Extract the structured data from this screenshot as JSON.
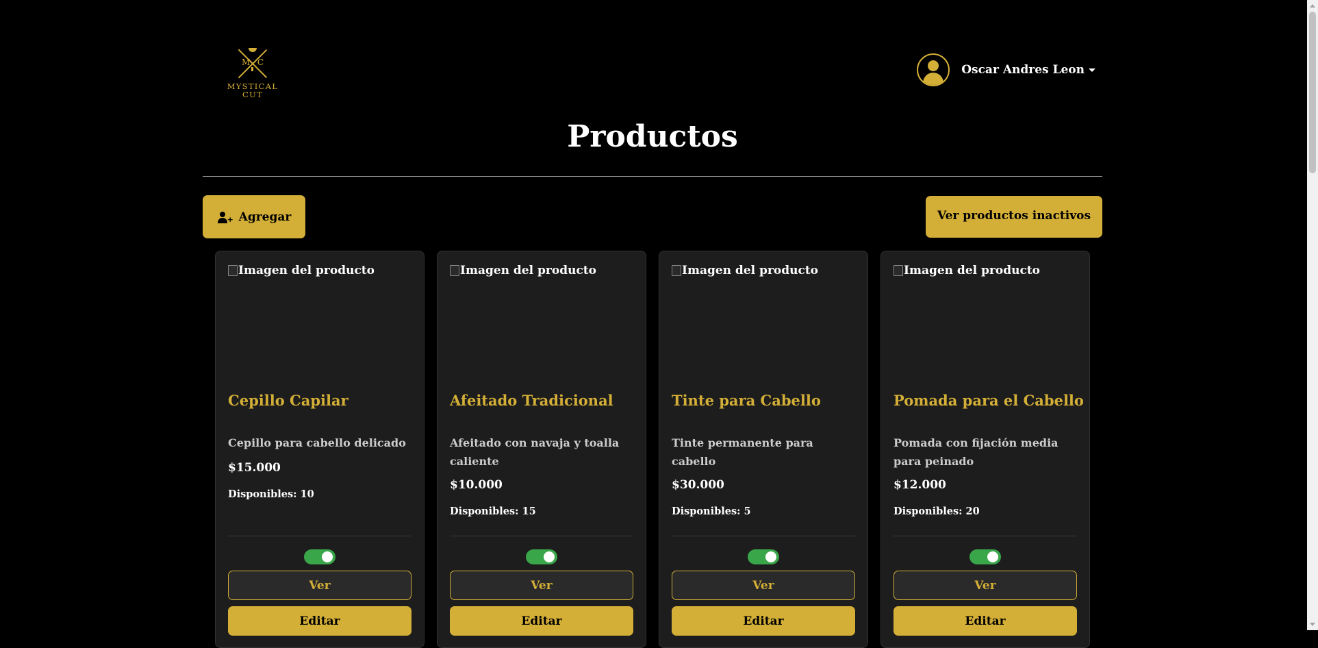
{
  "brand": {
    "mark_left": "M",
    "mark_right": "C",
    "line1": "MYSTICAL",
    "line2": "CUT"
  },
  "user": {
    "name": "Oscar Andres Leon"
  },
  "page_title": "Productos",
  "actions": {
    "add_label": "Agregar",
    "inactive_label": "Ver productos inactivos"
  },
  "colors": {
    "accent": "#d4af37",
    "toggle_on": "#3aa64a",
    "card_bg": "#1d1d1d"
  },
  "products": [
    {
      "image_alt": "Imagen del producto",
      "name": "Cepillo Capilar",
      "description": "Cepillo para cabello delicado",
      "price": "$15.000",
      "stock": "Disponibles: 10",
      "active": true,
      "view_label": "Ver",
      "edit_label": "Editar"
    },
    {
      "image_alt": "Imagen del producto",
      "name": "Afeitado Tradicional",
      "description": "Afeitado con navaja y toalla caliente",
      "price": "$10.000",
      "stock": "Disponibles: 15",
      "active": true,
      "view_label": "Ver",
      "edit_label": "Editar"
    },
    {
      "image_alt": "Imagen del producto",
      "name": "Tinte para Cabello",
      "description": "Tinte permanente para cabello",
      "price": "$30.000",
      "stock": "Disponibles: 5",
      "active": true,
      "view_label": "Ver",
      "edit_label": "Editar"
    },
    {
      "image_alt": "Imagen del producto",
      "name": "Pomada para el Cabello",
      "description": "Pomada con fijación media para peinado",
      "price": "$12.000",
      "stock": "Disponibles: 20",
      "active": true,
      "view_label": "Ver",
      "edit_label": "Editar"
    }
  ]
}
